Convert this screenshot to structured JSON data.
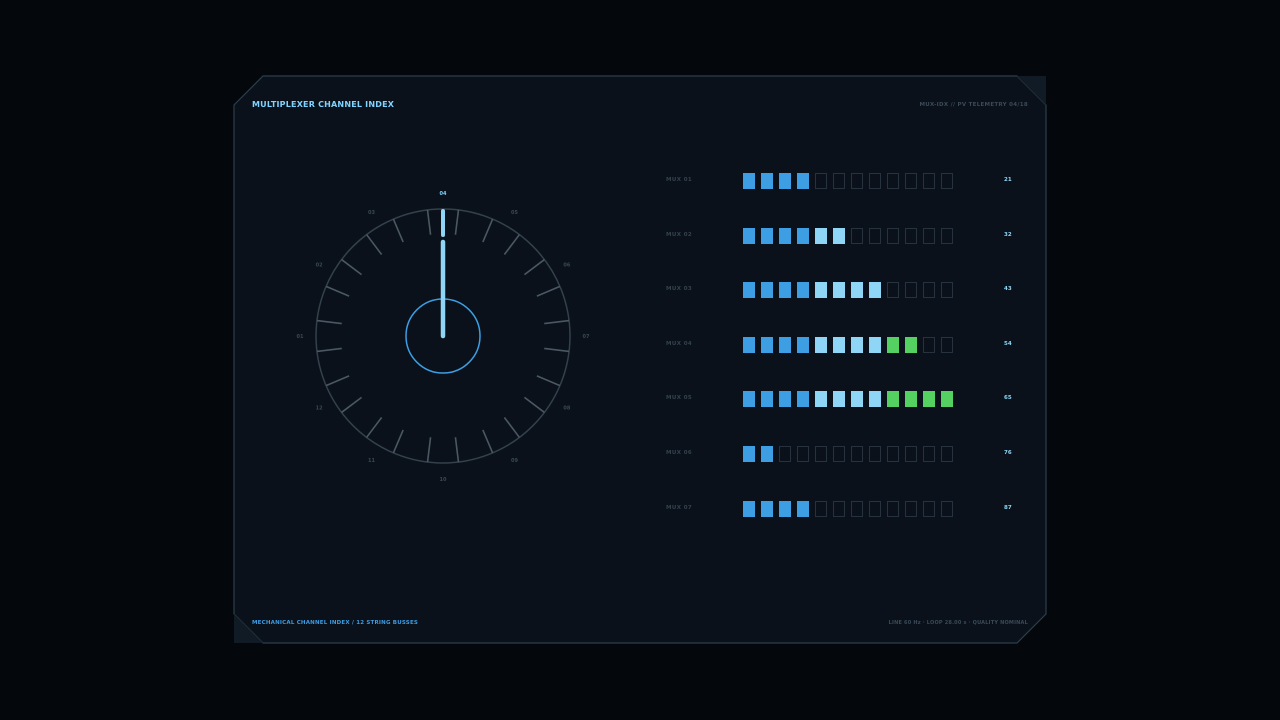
{
  "header": {
    "title": "MULTIPLEXER CHANNEL INDEX",
    "right": "MUX-IDX // PV TELEMETRY 04/18"
  },
  "footer": {
    "left": "MECHANICAL CHANNEL INDEX / 12 STRING BUSSES",
    "right": "LINE 60 Hz · LOOP 28.00 s · QUALITY NOMINAL"
  },
  "dial": {
    "labels": [
      "01",
      "02",
      "03",
      "04",
      "05",
      "06",
      "07",
      "08",
      "09",
      "10",
      "11",
      "12"
    ],
    "selected": "04",
    "selected_index": 3
  },
  "mux": {
    "segments": 12,
    "rows": [
      {
        "label": "MUX 01",
        "lit": 4,
        "value": "21"
      },
      {
        "label": "MUX 02",
        "lit": 6,
        "value": "32"
      },
      {
        "label": "MUX 03",
        "lit": 8,
        "value": "43"
      },
      {
        "label": "MUX 04",
        "lit": 10,
        "value": "54"
      },
      {
        "label": "MUX 05",
        "lit": 12,
        "value": "65"
      },
      {
        "label": "MUX 06",
        "lit": 2,
        "value": "76"
      },
      {
        "label": "MUX 07",
        "lit": 4,
        "value": "87"
      }
    ]
  },
  "colors": {
    "segment_blue": "#3d9ee3",
    "segment_light": "#8fd6f6",
    "segment_green": "#54d160",
    "segment_off": "#26323d",
    "accent": "#7fd3ff"
  }
}
